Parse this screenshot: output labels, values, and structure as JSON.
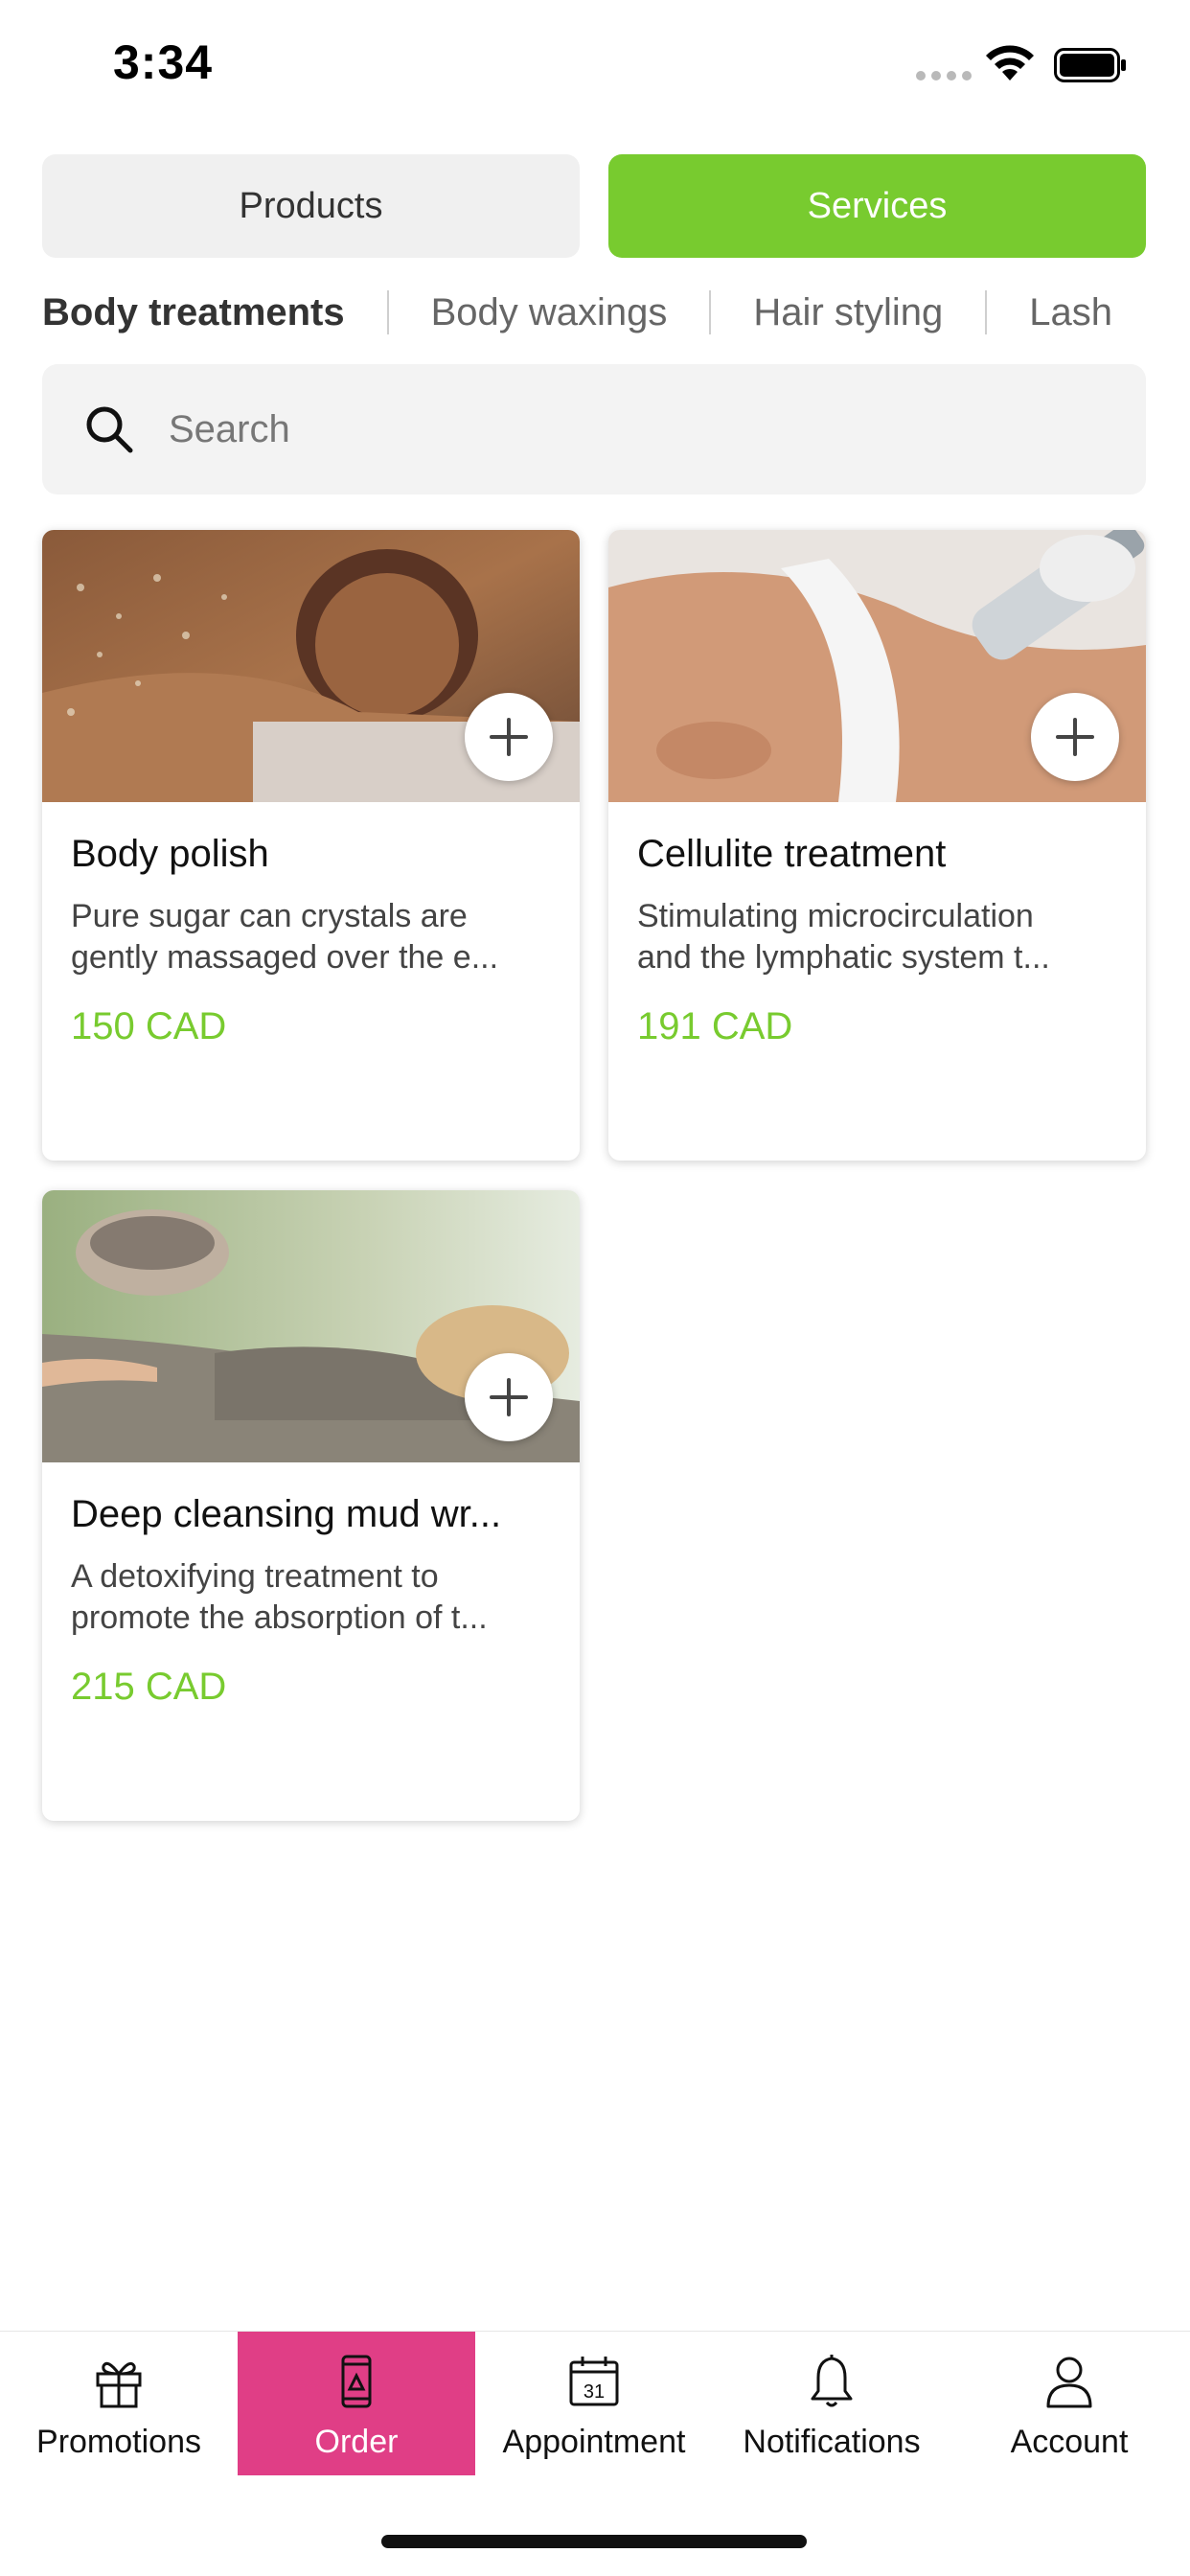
{
  "status_bar": {
    "time": "3:34"
  },
  "segments": {
    "products_label": "Products",
    "services_label": "Services",
    "active": "Services"
  },
  "colors": {
    "accent_green": "#78cb2f",
    "nav_active": "#e03e86"
  },
  "categories": [
    "Body treatments",
    "Body waxings",
    "Hair styling",
    "Lash"
  ],
  "search": {
    "placeholder": "Search"
  },
  "products": [
    {
      "title": "Body polish",
      "desc_line1": "Pure sugar can crystals are",
      "desc_line2": "gently massaged over the e...",
      "price": "150 CAD"
    },
    {
      "title": "Cellulite treatment",
      "desc_line1": "Stimulating microcirculation",
      "desc_line2": "and the lymphatic system t...",
      "price": "191 CAD"
    },
    {
      "title": "Deep cleansing mud wr...",
      "desc_line1": "A detoxifying treatment to",
      "desc_line2": "promote the absorption of t...",
      "price": "215 CAD"
    }
  ],
  "nav": {
    "items": [
      {
        "label": "Promotions",
        "icon": "gift-icon"
      },
      {
        "label": "Order",
        "icon": "phone-order-icon"
      },
      {
        "label": "Appointment",
        "icon": "calendar-icon"
      },
      {
        "label": "Notifications",
        "icon": "bell-icon"
      },
      {
        "label": "Account",
        "icon": "user-icon"
      }
    ],
    "active": "Order"
  },
  "calendar_day": "31"
}
